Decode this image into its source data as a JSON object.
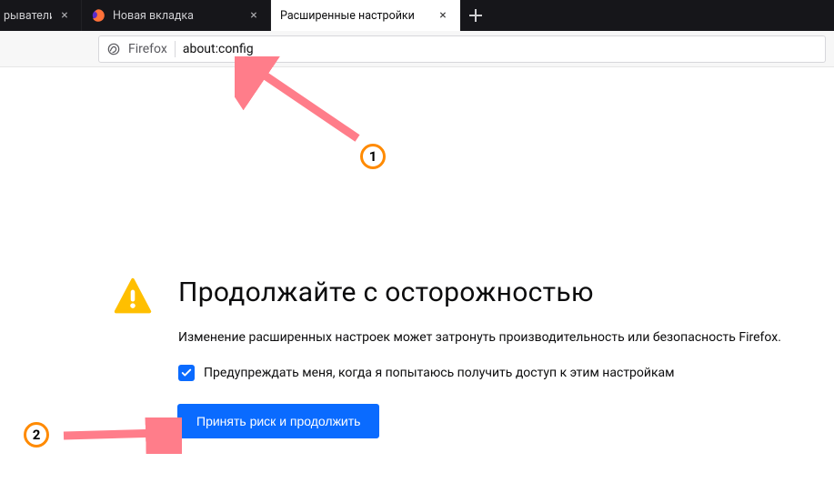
{
  "tabs": {
    "partial_label": "рыватели ·",
    "second_label": "Новая вкладка",
    "active_label": "Расширенные настройки"
  },
  "toolbar": {
    "brand": "Firefox",
    "url": "about:config"
  },
  "warning": {
    "heading": "Продолжайте с осторожностью",
    "body": "Изменение расширенных настроек может затронуть производительность или безопасность Firefox.",
    "checkbox_label": "Предупреждать меня, когда я попытаюсь получить доступ к этим настройкам",
    "accept_label": "Принять риск и продолжить"
  },
  "annotations": {
    "one": "1",
    "two": "2"
  }
}
